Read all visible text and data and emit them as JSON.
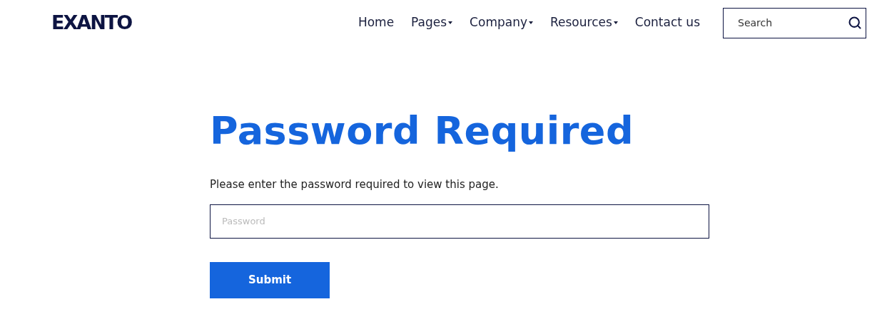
{
  "logo": "EXANTO",
  "nav": [
    {
      "label": "Home",
      "dropdown": false
    },
    {
      "label": "Pages",
      "dropdown": true
    },
    {
      "label": "Company",
      "dropdown": true
    },
    {
      "label": "Resources",
      "dropdown": true
    },
    {
      "label": "Contact us",
      "dropdown": false
    }
  ],
  "search": {
    "placeholder": "Search"
  },
  "heading": "Password Required",
  "instructions": "Please enter the password required to view this page.",
  "password": {
    "placeholder": "Password"
  },
  "submit": "Submit"
}
